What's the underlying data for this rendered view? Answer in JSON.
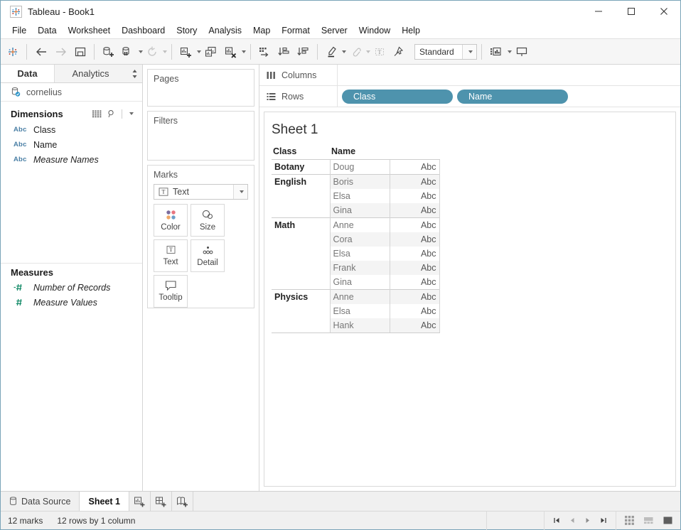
{
  "window": {
    "title": "Tableau - Book1",
    "app_icon": "tableau-logo-icon",
    "minimize": "minimize-icon",
    "maximize": "maximize-icon",
    "close": "close-icon"
  },
  "menubar": {
    "items": [
      "File",
      "Data",
      "Worksheet",
      "Dashboard",
      "Story",
      "Analysis",
      "Map",
      "Format",
      "Server",
      "Window",
      "Help"
    ]
  },
  "toolbar": {
    "fit_value": "Standard",
    "buttons": [
      "tableau-home-icon",
      "back-arrow-icon",
      "forward-arrow-icon",
      "save-icon",
      "new-data-source-icon",
      "pause-data-updates-icon",
      "refresh-data-source-icon",
      "new-worksheet-icon",
      "duplicate-sheet-icon",
      "clear-sheet-icon",
      "swap-rows-columns-icon",
      "sort-ascending-icon",
      "sort-descending-icon",
      "highlight-icon",
      "fix-axes-icon",
      "show-mark-labels-icon",
      "presentation-mode-icon",
      "show-me-icon",
      "slideshow-icon"
    ]
  },
  "datapane": {
    "tabs": [
      {
        "label": "Data",
        "active": true
      },
      {
        "label": "Analytics",
        "active": false
      }
    ],
    "datasource": {
      "name": "cornelius",
      "icon": "database-connected-icon"
    },
    "dimensions": {
      "title": "Dimensions",
      "tools": [
        "grid-view-icon",
        "search-icon",
        "chevron-down-icon"
      ],
      "fields": [
        {
          "label": "Class",
          "type": "Abc",
          "italic": false
        },
        {
          "label": "Name",
          "type": "Abc",
          "italic": false
        },
        {
          "label": "Measure Names",
          "type": "Abc",
          "italic": true
        }
      ]
    },
    "measures": {
      "title": "Measures",
      "fields": [
        {
          "label": "Number of Records",
          "type": "#",
          "italic": true
        },
        {
          "label": "Measure Values",
          "type": "#",
          "italic": true
        }
      ]
    }
  },
  "cards": {
    "pages": {
      "title": "Pages"
    },
    "filters": {
      "title": "Filters"
    },
    "marks": {
      "title": "Marks",
      "mark_type": "Text",
      "mark_type_icon": "text-mark-icon",
      "buttons": [
        {
          "label": "Color",
          "icon": "color-dots-icon"
        },
        {
          "label": "Size",
          "icon": "size-circles-icon"
        },
        {
          "label": "Text",
          "icon": "text-box-icon"
        },
        {
          "label": "Detail",
          "icon": "detail-dots-icon"
        },
        {
          "label": "Tooltip",
          "icon": "tooltip-bubble-icon"
        }
      ]
    }
  },
  "shelves": {
    "columns": {
      "label": "Columns",
      "icon": "columns-icon",
      "pills": []
    },
    "rows": {
      "label": "Rows",
      "icon": "rows-icon",
      "pills": [
        "Class",
        "Name"
      ]
    }
  },
  "view": {
    "sheet_title": "Sheet 1",
    "headers": [
      "Class",
      "Name",
      ""
    ],
    "rows": [
      {
        "class": "Botany",
        "name": "Doug",
        "value": "Abc",
        "band": false,
        "group_start": true
      },
      {
        "class": "English",
        "name": "Boris",
        "value": "Abc",
        "band": true,
        "group_start": true
      },
      {
        "class": "",
        "name": "Elsa",
        "value": "Abc",
        "band": false,
        "group_start": false
      },
      {
        "class": "",
        "name": "Gina",
        "value": "Abc",
        "band": true,
        "group_start": false
      },
      {
        "class": "Math",
        "name": "Anne",
        "value": "Abc",
        "band": false,
        "group_start": true
      },
      {
        "class": "",
        "name": "Cora",
        "value": "Abc",
        "band": true,
        "group_start": false
      },
      {
        "class": "",
        "name": "Elsa",
        "value": "Abc",
        "band": false,
        "group_start": false
      },
      {
        "class": "",
        "name": "Frank",
        "value": "Abc",
        "band": true,
        "group_start": false
      },
      {
        "class": "",
        "name": "Gina",
        "value": "Abc",
        "band": false,
        "group_start": false
      },
      {
        "class": "Physics",
        "name": "Anne",
        "value": "Abc",
        "band": true,
        "group_start": true
      },
      {
        "class": "",
        "name": "Elsa",
        "value": "Abc",
        "band": false,
        "group_start": false
      },
      {
        "class": "",
        "name": "Hank",
        "value": "Abc",
        "band": true,
        "group_start": false
      }
    ]
  },
  "tabbar": {
    "data_source": {
      "label": "Data Source",
      "icon": "database-icon"
    },
    "sheets": [
      {
        "label": "Sheet 1",
        "active": true
      }
    ],
    "new_buttons": [
      "new-worksheet-icon",
      "new-dashboard-icon",
      "new-story-icon"
    ]
  },
  "statusbar": {
    "marks": "12 marks",
    "dimensions": "12 rows by 1 column",
    "nav": [
      "first-page-icon",
      "previous-page-icon",
      "next-page-icon",
      "last-page-icon"
    ],
    "views": [
      "grid-view-icon",
      "split-view-icon",
      "full-view-icon"
    ]
  },
  "colors": {
    "pill_blue": "#4e93ad",
    "accent_border": "#7aa4b8",
    "abc_blue": "#4a7fa5",
    "measure_green": "#1d8f6e",
    "band_gray": "#f4f4f4"
  }
}
